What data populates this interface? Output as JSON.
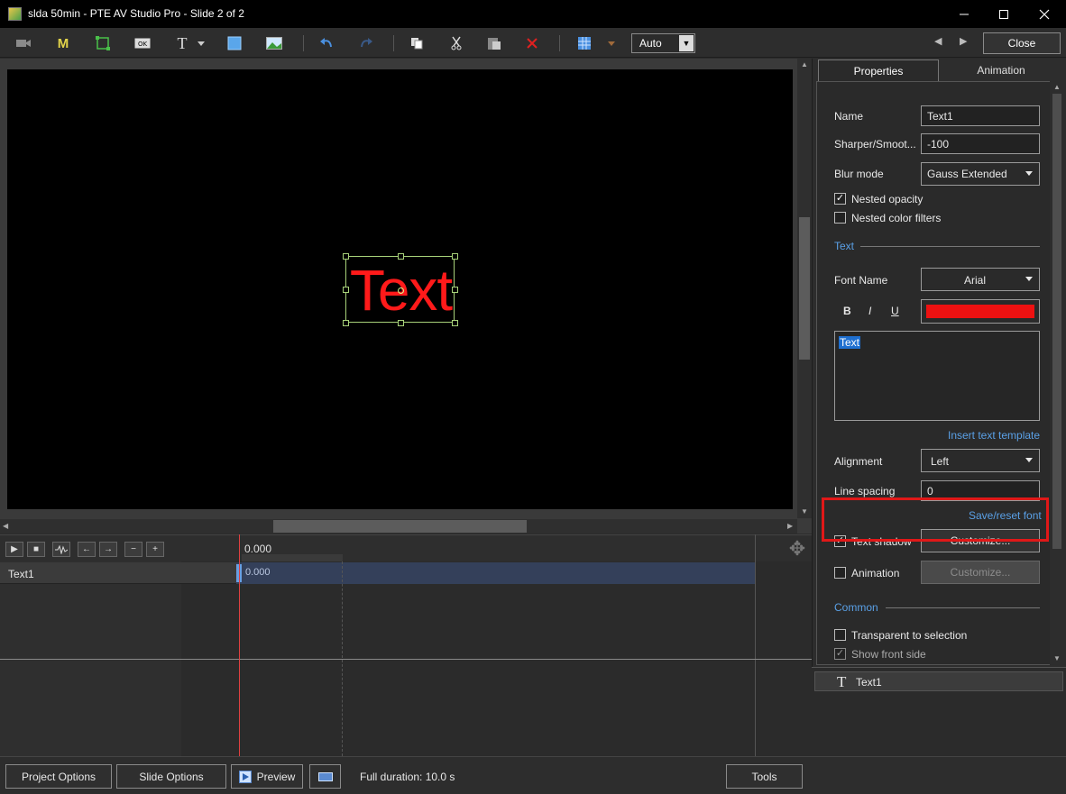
{
  "window": {
    "title": "slda 50min - PTE AV Studio Pro - Slide 2 of 2"
  },
  "toolbar": {
    "mode_select": "Auto",
    "close_label": "Close",
    "icons": [
      "camera-icon",
      "mask-icon",
      "frame-icon",
      "button-icon",
      "text-icon",
      "rectangle-icon",
      "image-icon",
      "undo-icon",
      "redo-icon",
      "copy-icon",
      "cut-icon",
      "paste-icon",
      "delete-icon",
      "grid-icon"
    ]
  },
  "stage": {
    "text": "Text",
    "text_color": "#ff1a1a"
  },
  "timeline": {
    "time_top": "0.000",
    "row_label": "Text1",
    "row_time": "0.000"
  },
  "panel": {
    "tabs": {
      "properties": "Properties",
      "animation": "Animation"
    },
    "name_label": "Name",
    "name_value": "Text1",
    "sharper_label": "Sharper/Smoot...",
    "sharper_value": "-100",
    "blur_label": "Blur mode",
    "blur_value": "Gauss Extended",
    "nested_opacity": "Nested opacity",
    "nested_color": "Nested color filters",
    "text_section": "Text",
    "font_label": "Font Name",
    "font_value": "Arial",
    "bold": "B",
    "italic": "I",
    "underline": "U",
    "font_color": "#ee1111",
    "text_content": "Text",
    "insert_template": "Insert text template",
    "alignment_label": "Alignment",
    "alignment_value": "Left",
    "line_spacing_label": "Line spacing",
    "line_spacing_value": "0",
    "save_reset": "Save/reset font",
    "text_shadow": "Text shadow",
    "customize": "Customize...",
    "animation_label": "Animation",
    "customize2": "Customize...",
    "common_section": "Common",
    "transparent": "Transparent to selection",
    "front_side": "Show front side"
  },
  "object_list": {
    "item": "Text1"
  },
  "bottom": {
    "project_options": "Project Options",
    "slide_options": "Slide Options",
    "preview": "Preview",
    "duration": "Full duration: 10.0 s",
    "tools": "Tools"
  }
}
